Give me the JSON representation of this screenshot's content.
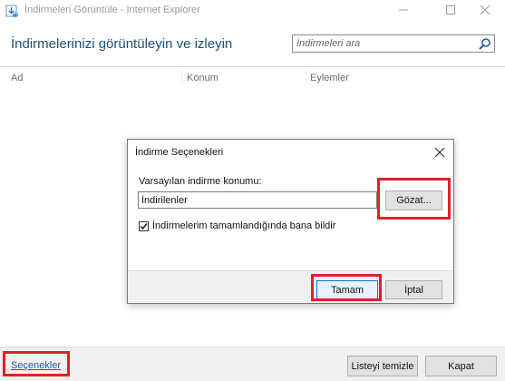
{
  "window": {
    "title": "İndirmeleri Görüntüle - Internet Explorer",
    "icon": "ie-download-icon",
    "controls": [
      "minimize-icon",
      "maximize-icon",
      "close-icon"
    ]
  },
  "header": {
    "heading": "İndirmelerinizi görüntüleyin ve izleyin",
    "search_placeholder": "İndirmeleri ara",
    "search_icon": "search-icon"
  },
  "columns": [
    "Ad",
    "Konum",
    "Eylemler"
  ],
  "footer": {
    "options_link": "Seçenekler",
    "clear_list": "Listeyi temizle",
    "close": "Kapat"
  },
  "dialog": {
    "title": "İndirme Seçenekleri",
    "default_location_label": "Varsayılan indirme konumu:",
    "default_location_value": "İndirilenler",
    "browse": "Gözat...",
    "notify_label": "İndirmelerim tamamlandığında bana bildir",
    "notify_checked": true,
    "ok": "Tamam",
    "cancel": "İptal"
  },
  "colors": {
    "heading": "#1f4e79",
    "link": "#1a5fb4",
    "highlight": "#e0202a",
    "footer_bg": "#f0f0f0"
  }
}
